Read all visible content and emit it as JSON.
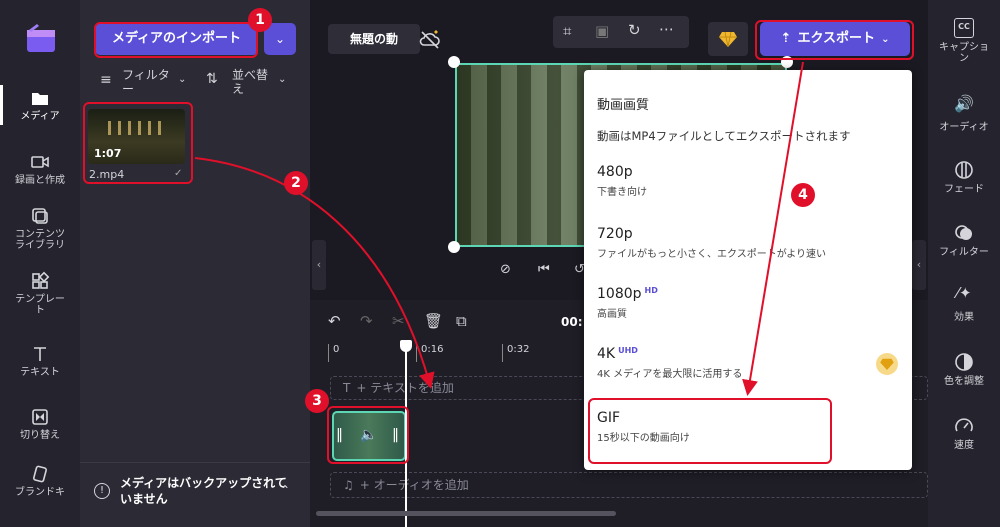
{
  "left_nav": [
    {
      "label": "メディア",
      "icon": "folder-icon",
      "active": true
    },
    {
      "label": "録画と作成",
      "icon": "video-camera-icon"
    },
    {
      "label": "コンテンツライブラリ",
      "icon": "library-icon"
    },
    {
      "label": "テンプレート",
      "icon": "template-icon"
    },
    {
      "label": "テキスト",
      "icon": "text-icon"
    },
    {
      "label": "切り替え",
      "icon": "transition-icon"
    },
    {
      "label": "ブランドキ",
      "icon": "brand-kit-icon"
    }
  ],
  "media": {
    "import_label": "メディアのインポート",
    "filter_label": "フィルター",
    "sort_label": "並べ替え",
    "file_duration": "1:07",
    "file_name": "2.mp4",
    "backup_text": "メディアはバックアップされていません"
  },
  "header": {
    "project_title": "無題の動",
    "export_label": "エクスポート"
  },
  "timeline": {
    "ticks": [
      "0",
      "0:16",
      "0:32"
    ],
    "time_readout": "00:",
    "add_text": "+ テキストを追加",
    "add_audio": "+ オーディオを追加"
  },
  "export_menu": {
    "title": "動画画質",
    "description": "動画はMP4ファイルとしてエクスポートされます",
    "options": [
      {
        "name": "480p",
        "sup": "",
        "desc": "下書き向け"
      },
      {
        "name": "720p",
        "sup": "",
        "desc": "ファイルがもっと小さく、エクスポートがより速い"
      },
      {
        "name": "1080p",
        "sup": "HD",
        "desc": "高画質"
      },
      {
        "name": "4K",
        "sup": "UHD",
        "desc": "4K メディアを最大限に活用する"
      },
      {
        "name": "GIF",
        "sup": "",
        "desc": "15秒以下の動画向け"
      }
    ]
  },
  "right_nav": [
    {
      "label": "キャプション",
      "icon": "cc-icon"
    },
    {
      "label": "オーディオ",
      "icon": "speaker-icon"
    },
    {
      "label": "フェード",
      "icon": "fade-icon"
    },
    {
      "label": "フィルター",
      "icon": "filter-icon"
    },
    {
      "label": "効果",
      "icon": "magic-wand-icon"
    },
    {
      "label": "色を調整",
      "icon": "contrast-icon"
    },
    {
      "label": "速度",
      "icon": "speedometer-icon"
    }
  ],
  "annotations": [
    "1",
    "2",
    "3",
    "4"
  ],
  "colors": {
    "accent": "#5a4fd6",
    "annotation_red": "#e0102a",
    "selection_teal": "#5dd6b3"
  }
}
